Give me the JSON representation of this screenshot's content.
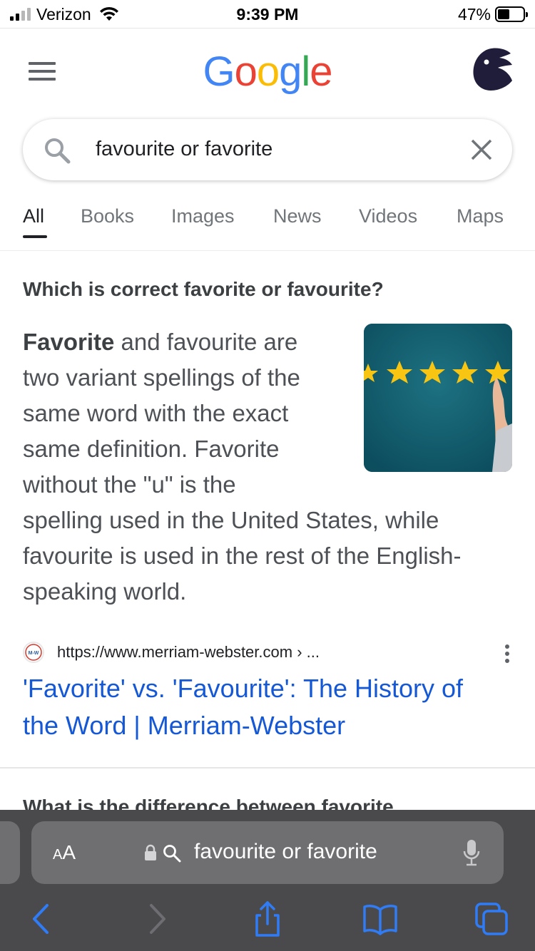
{
  "status_bar": {
    "carrier": "Verizon",
    "time": "9:39 PM",
    "battery_percent": "47%",
    "battery_level": 0.47,
    "signal_bars": 2
  },
  "header": {
    "logo_letters": [
      "G",
      "o",
      "o",
      "g",
      "l",
      "e"
    ],
    "logo_colors": [
      "#4285F4",
      "#EA4335",
      "#FBBC05",
      "#4285F4",
      "#34A853",
      "#EA4335"
    ]
  },
  "search": {
    "query": "favourite or favorite"
  },
  "tabs": [
    {
      "label": "All",
      "active": true
    },
    {
      "label": "Books"
    },
    {
      "label": "Images"
    },
    {
      "label": "News"
    },
    {
      "label": "Videos"
    },
    {
      "label": "Maps"
    }
  ],
  "snippet": {
    "question": "Which is correct favorite or favourite?",
    "bold_word": "Favorite",
    "lines": [
      " and favourite are",
      "two variant spellings of the",
      "same word with the exact",
      "same definition. Favorite",
      "without the \"u\" is the",
      "spelling used in the United States, while",
      "favourite is used in the rest of the English-",
      "speaking world."
    ],
    "source_url": "https://www.merriam-webster.com › ...",
    "favicon_text": "M-W",
    "title_line1": "'Favorite' vs. 'Favourite': The History of",
    "title_line2": "the Word | Merriam-Webster"
  },
  "next_question": "What is the difference between favorite",
  "safari": {
    "aa_label_big": "A",
    "aa_label_small": "A",
    "address_text": "favourite or favorite"
  },
  "colors": {
    "link": "#1558d6",
    "toolbar_icon": "#2f7cf6",
    "toolbar_disabled": "#6e6e72"
  }
}
